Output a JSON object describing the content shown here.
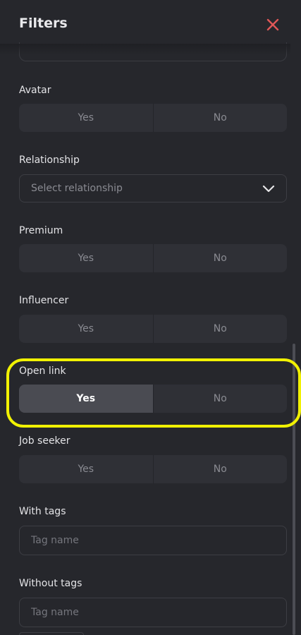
{
  "header": {
    "title": "Filters",
    "close_icon": "close-icon",
    "close_color": "#e05757"
  },
  "filters": {
    "avatar": {
      "label": "Avatar",
      "yes": "Yes",
      "no": "No",
      "selected": null
    },
    "relationship": {
      "label": "Relationship",
      "placeholder": "Select relationship",
      "chevron_icon": "chevron-down-icon"
    },
    "premium": {
      "label": "Premium",
      "yes": "Yes",
      "no": "No",
      "selected": null
    },
    "influencer": {
      "label": "Influencer",
      "yes": "Yes",
      "no": "No",
      "selected": null
    },
    "open_link": {
      "label": "Open link",
      "yes": "Yes",
      "no": "No",
      "selected": "Yes"
    },
    "job_seeker": {
      "label": "Job seeker",
      "yes": "Yes",
      "no": "No",
      "selected": null
    },
    "with_tags": {
      "label": "With tags",
      "placeholder": "Tag name"
    },
    "without_tags": {
      "label": "Without tags",
      "placeholder": "Tag name"
    }
  },
  "colors": {
    "background": "#26272c",
    "toggle_bg": "#2f3036",
    "toggle_active": "#4a4b52",
    "highlight": "#f1f103"
  }
}
